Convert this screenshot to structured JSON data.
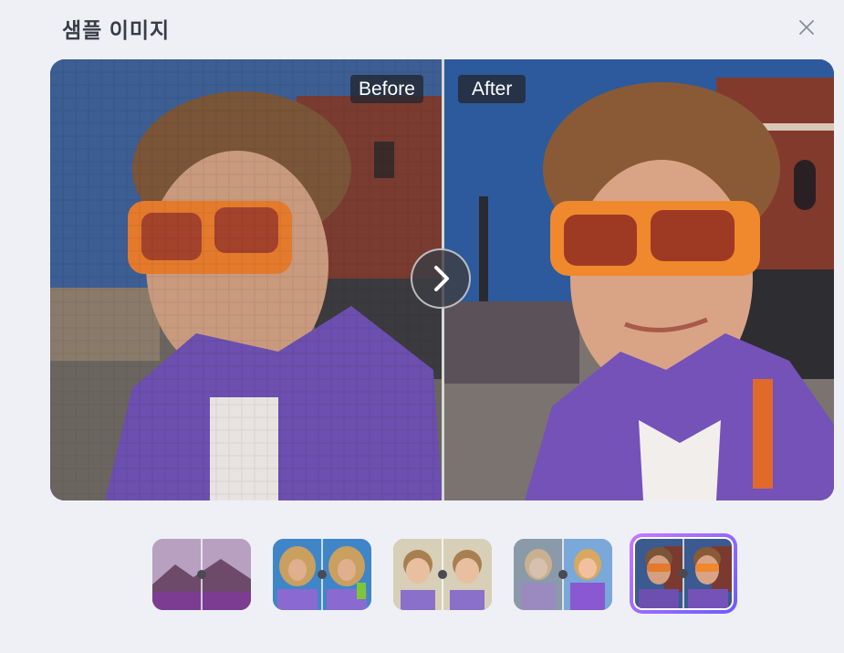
{
  "dialog": {
    "title": "샘플 이미지",
    "close_icon": "close-icon"
  },
  "compare": {
    "before_label": "Before",
    "after_label": "After",
    "next_icon": "chevron-right-icon",
    "divider_color": "#d7d7d7"
  },
  "thumbnails": [
    {
      "name": "thumb-landscape-lavender",
      "selected": false
    },
    {
      "name": "thumb-woman-curly-hair",
      "selected": false
    },
    {
      "name": "thumb-child-portrait",
      "selected": false
    },
    {
      "name": "thumb-girl-purple-jacket",
      "selected": false
    },
    {
      "name": "thumb-man-orange-sunglasses",
      "selected": true
    }
  ],
  "colors": {
    "background": "#eef0f6",
    "title_text": "#3a3d45",
    "selected_border_start": "#c878ff",
    "selected_border_end": "#6a5cff"
  }
}
